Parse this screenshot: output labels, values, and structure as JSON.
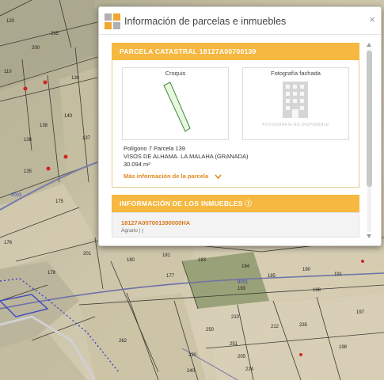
{
  "popup": {
    "title": "Información de parcelas e inmuebles",
    "close_icon": "×",
    "parcela": {
      "header": "PARCELA CATASTRAL 18127A00700139",
      "croquis_label": "Croquis",
      "foto_label": "Fotografía fachada",
      "foto_placeholder": "FOTOGRAFÍA NO DISPONIBLE",
      "line1": "Polígono 7 Parcela 139",
      "line2": "VISOS DE ALHAMA. LA MALAHA (GRANADA)",
      "area": "30.094 m²",
      "more_link": "Más información de la parcela"
    },
    "inmuebles": {
      "header": "INFORMACIÓN DE LOS INMUEBLES ⓘ",
      "items": [
        {
          "ref": "18127A007001390000HA",
          "use": "Agrario | |"
        }
      ]
    }
  },
  "map": {
    "labels": [
      {
        "text": "265"
      },
      {
        "text": "120"
      },
      {
        "text": "200"
      },
      {
        "text": "110"
      },
      {
        "text": "138"
      },
      {
        "text": "140"
      },
      {
        "text": "130"
      },
      {
        "text": "137"
      },
      {
        "text": "136"
      },
      {
        "text": "135"
      },
      {
        "text": "175"
      },
      {
        "text": "176"
      },
      {
        "text": "178"
      },
      {
        "text": "201"
      },
      {
        "text": "180"
      },
      {
        "text": "181"
      },
      {
        "text": "183"
      },
      {
        "text": "184"
      },
      {
        "text": "185"
      },
      {
        "text": "190"
      },
      {
        "text": "191"
      },
      {
        "text": "193"
      },
      {
        "text": "210"
      },
      {
        "text": "212"
      },
      {
        "text": "262"
      },
      {
        "text": "250"
      },
      {
        "text": "251"
      },
      {
        "text": "205"
      },
      {
        "text": "224"
      },
      {
        "text": "235"
      },
      {
        "text": "177"
      },
      {
        "text": "198"
      },
      {
        "text": "197"
      },
      {
        "text": "188"
      },
      {
        "text": "230"
      },
      {
        "text": "240"
      },
      {
        "text": "9003"
      },
      {
        "text": "9001"
      }
    ]
  },
  "colors": {
    "accent": "#f6b840",
    "link": "#e08a1e",
    "parcel_fill": "#e9f7df",
    "parcel_stroke": "#3c8a3a",
    "road_blue": "#3a46c8"
  }
}
